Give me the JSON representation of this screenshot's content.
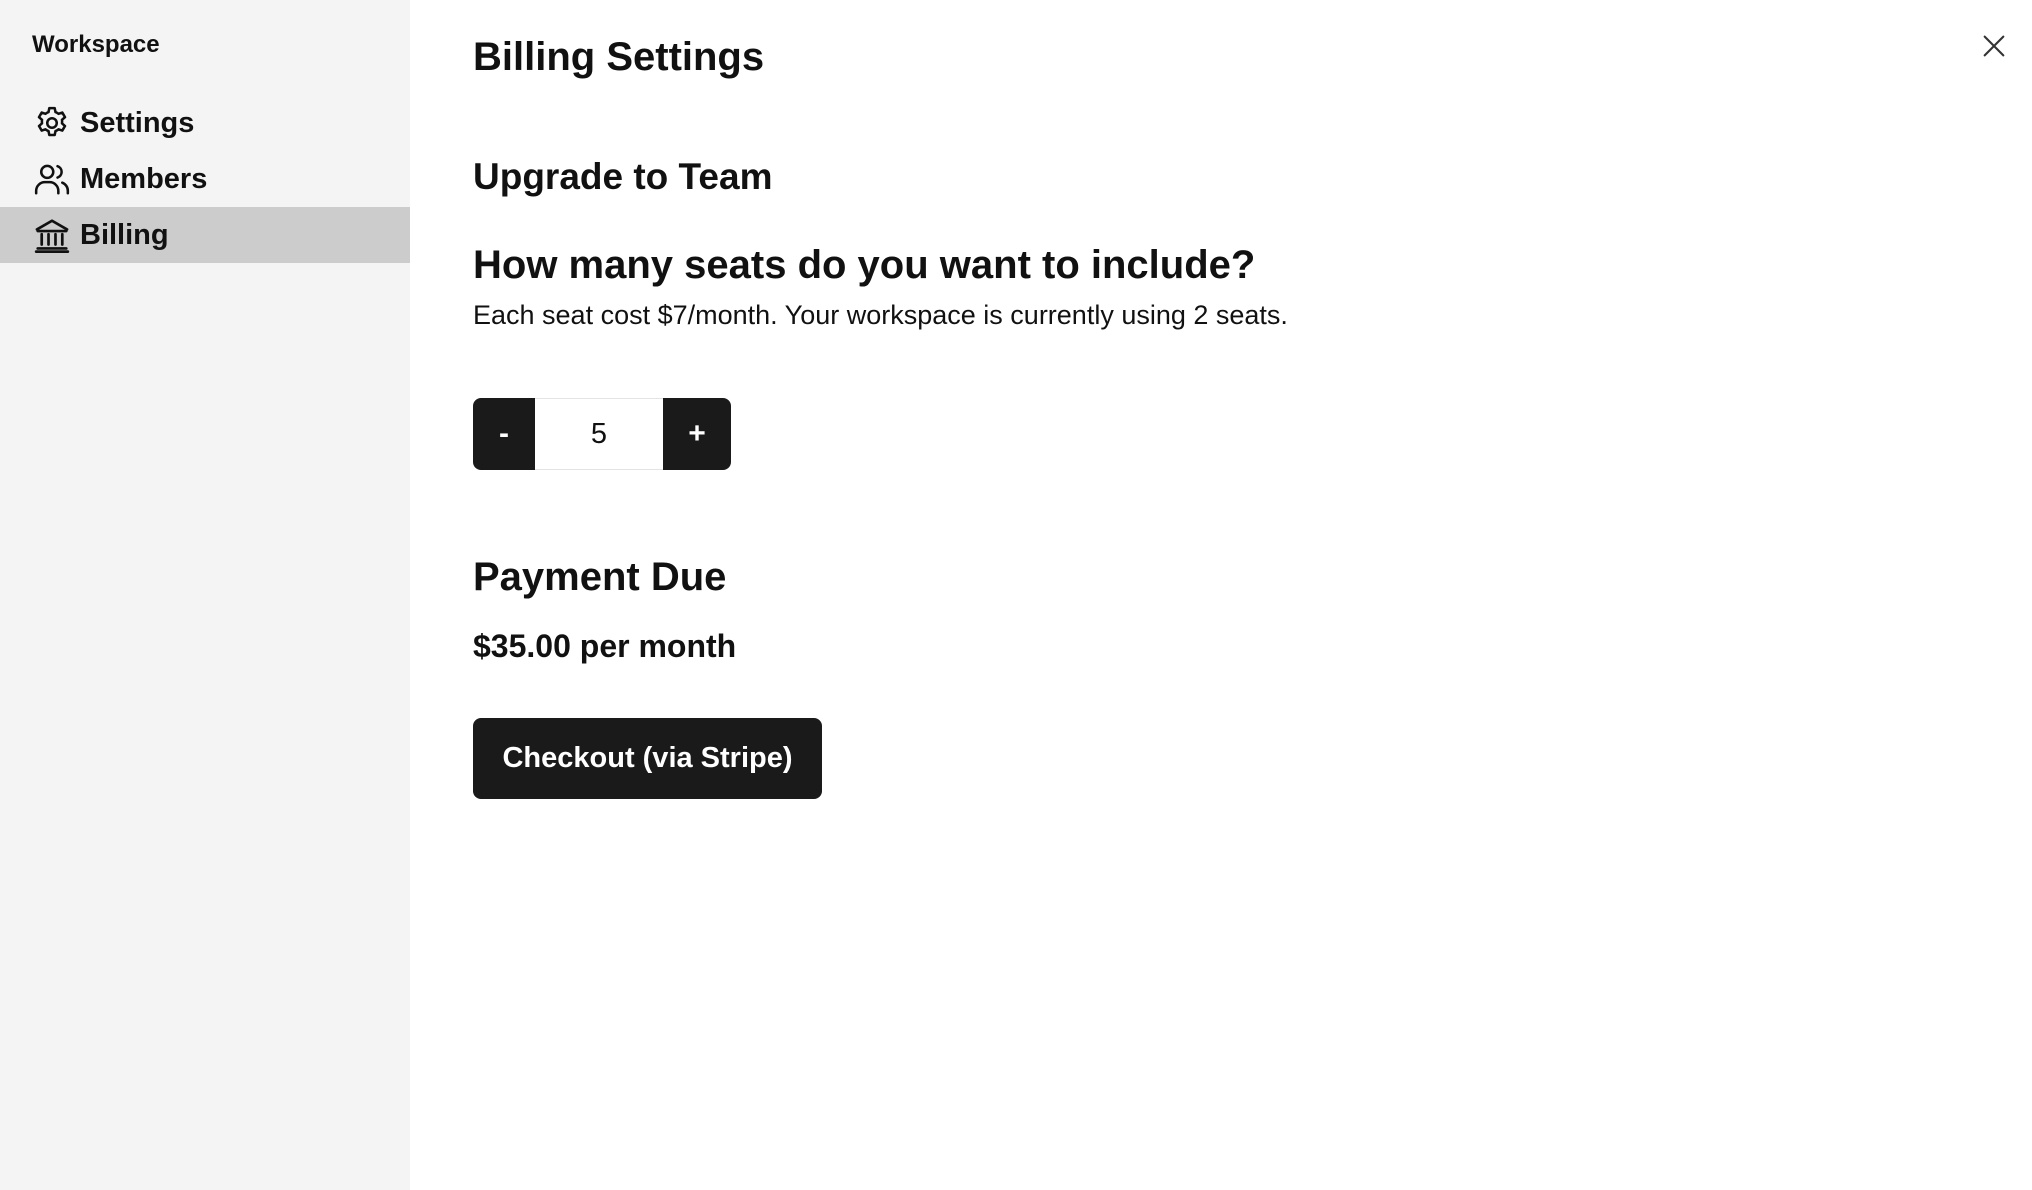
{
  "sidebar": {
    "workspace_label": "Workspace",
    "items": [
      {
        "label": "Settings",
        "icon": "gear-icon",
        "active": false
      },
      {
        "label": "Members",
        "icon": "users-icon",
        "active": false
      },
      {
        "label": "Billing",
        "icon": "bank-icon",
        "active": true
      }
    ]
  },
  "header": {
    "title": "Billing Settings",
    "close_icon": "close-icon"
  },
  "upgrade": {
    "title": "Upgrade to Team",
    "question": "How many seats do you want to include?",
    "description": "Each seat cost $7/month. Your workspace is currently using 2 seats."
  },
  "seats": {
    "decrement_label": "-",
    "value": "5",
    "increment_label": "+"
  },
  "payment": {
    "title": "Payment Due",
    "amount": "$35.00 per month",
    "checkout_label": "Checkout (via Stripe)"
  },
  "colors": {
    "sidebar_bg": "#f4f4f4",
    "active_item_bg": "#cccccc",
    "button_bg": "#1a1a1a",
    "button_text": "#ffffff"
  }
}
